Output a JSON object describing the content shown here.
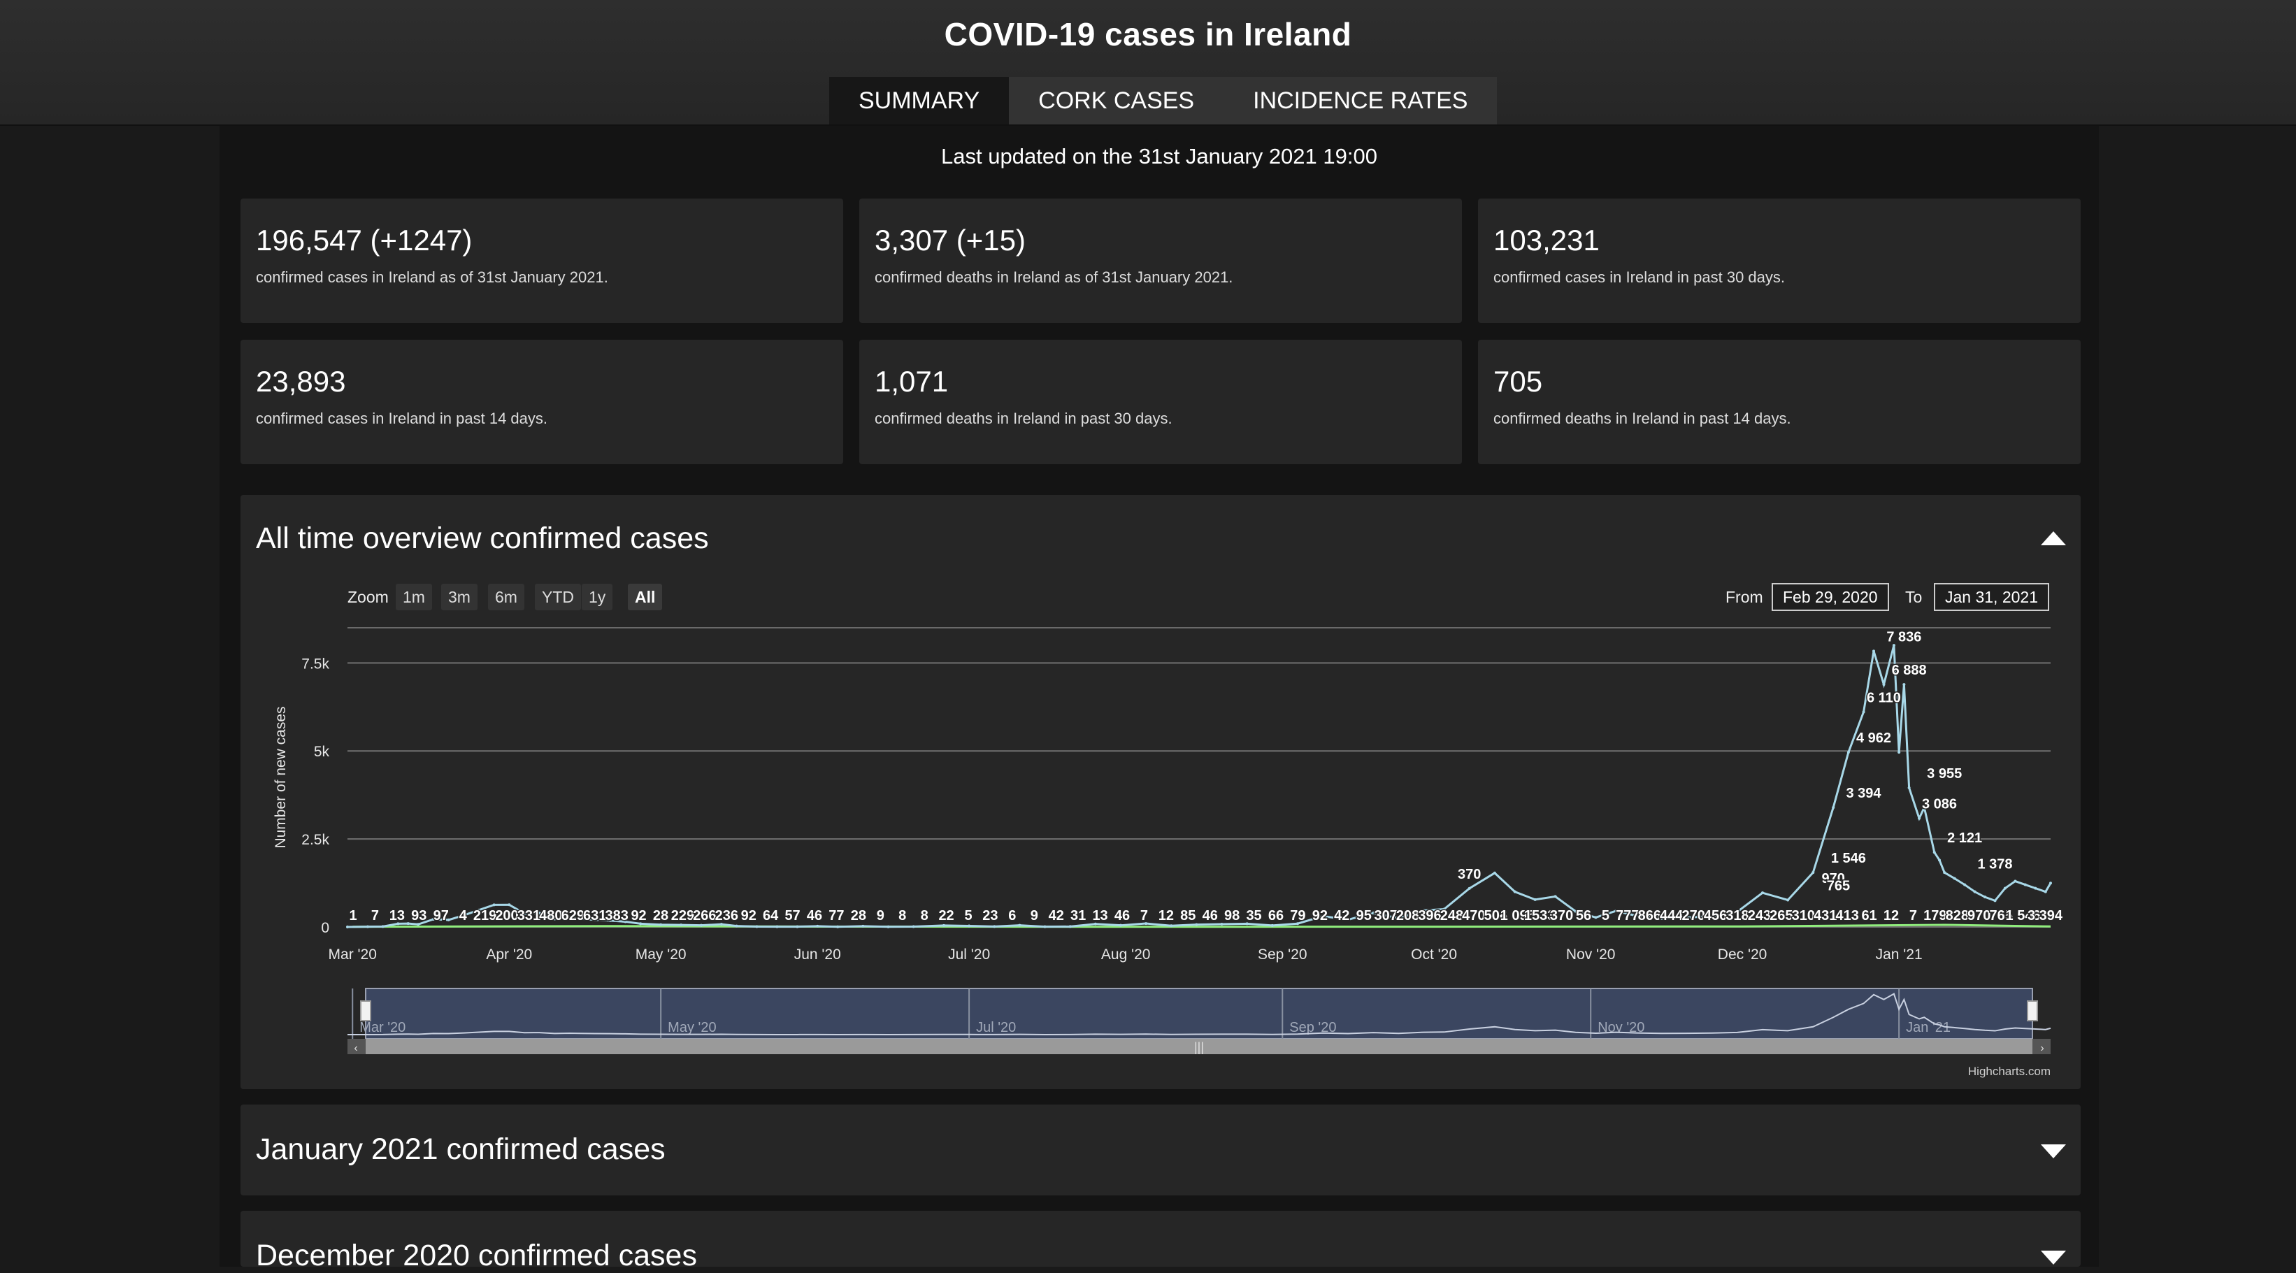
{
  "header": {
    "title": "COVID-19 cases in Ireland",
    "tabs": [
      {
        "label": "SUMMARY",
        "active": true
      },
      {
        "label": "CORK CASES",
        "active": false
      },
      {
        "label": "INCIDENCE RATES",
        "active": false
      }
    ]
  },
  "last_updated": "Last updated on the 31st January 2021 19:00",
  "stats": [
    {
      "value": "196,547 (+1247)",
      "description": "confirmed cases in Ireland as of 31st January 2021."
    },
    {
      "value": "3,307 (+15)",
      "description": "confirmed deaths in Ireland as of 31st January 2021."
    },
    {
      "value": "103,231",
      "description": "confirmed cases in Ireland in past 30 days."
    },
    {
      "value": "23,893",
      "description": "confirmed cases in Ireland in past 14 days."
    },
    {
      "value": "1,071",
      "description": "confirmed deaths in Ireland in past 30 days."
    },
    {
      "value": "705",
      "description": "confirmed deaths in Ireland in past 14 days."
    }
  ],
  "overview_panel": {
    "title": "All time overview confirmed cases",
    "range_selector": {
      "zoom_label": "Zoom",
      "buttons": [
        "1m",
        "3m",
        "6m",
        "YTD",
        "1y",
        "All"
      ],
      "selected": "All",
      "from_label": "From",
      "from_value": "Feb 29, 2020",
      "to_label": "To",
      "to_value": "Jan 31, 2021"
    },
    "credit": "Highcharts.com"
  },
  "collapsed_panels": [
    {
      "title": "January 2021 confirmed cases"
    },
    {
      "title": "December 2020 confirmed cases"
    }
  ],
  "colors": {
    "cases_line": "#a8d8e8",
    "deaths_line": "#90ed7d",
    "navigator_fill": "#3b4660"
  },
  "chart_data": {
    "type": "line",
    "ylabel": "Number of new cases",
    "ylim": [
      0,
      8500
    ],
    "yticks": [
      0,
      2500,
      5000,
      7500
    ],
    "ytick_labels": [
      "0",
      "2.5k",
      "5k",
      "7.5k"
    ],
    "x_tick_labels": [
      "Mar '20",
      "Apr '20",
      "May '20",
      "Jun '20",
      "Jul '20",
      "Aug '20",
      "Sep '20",
      "Oct '20",
      "Nov '20",
      "Dec '20",
      "Jan '21"
    ],
    "navigator_labels": [
      "Mar '20",
      "May '20",
      "Jul '20",
      "Sep '20",
      "Nov '20",
      "Jan '21"
    ],
    "grid": true,
    "series": [
      {
        "x": [
          "2020-02-29",
          "2020-03-04",
          "2020-03-07",
          "2020-03-10",
          "2020-03-12",
          "2020-03-14",
          "2020-03-17",
          "2020-03-20",
          "2020-03-23",
          "2020-03-26",
          "2020-03-29",
          "2020-04-01",
          "2020-04-04",
          "2020-04-07",
          "2020-04-10",
          "2020-04-13",
          "2020-04-15",
          "2020-04-18",
          "2020-04-21",
          "2020-04-24",
          "2020-04-27",
          "2020-05-01",
          "2020-05-05",
          "2020-05-09",
          "2020-05-13",
          "2020-05-16",
          "2020-05-20",
          "2020-05-24",
          "2020-05-28",
          "2020-06-01",
          "2020-06-05",
          "2020-06-10",
          "2020-06-15",
          "2020-06-20",
          "2020-06-26",
          "2020-07-01",
          "2020-07-06",
          "2020-07-11",
          "2020-07-16",
          "2020-07-21",
          "2020-07-26",
          "2020-07-31",
          "2020-08-05",
          "2020-08-10",
          "2020-08-15",
          "2020-08-20",
          "2020-08-25",
          "2020-08-30",
          "2020-09-04",
          "2020-09-09",
          "2020-09-14",
          "2020-09-19",
          "2020-09-24",
          "2020-09-29",
          "2020-10-03",
          "2020-10-08",
          "2020-10-13",
          "2020-10-17",
          "2020-10-21",
          "2020-10-25",
          "2020-10-29",
          "2020-11-02",
          "2020-11-06",
          "2020-11-10",
          "2020-11-15",
          "2020-11-20",
          "2020-11-25",
          "2020-11-30",
          "2020-12-05",
          "2020-12-10",
          "2020-12-15",
          "2020-12-19",
          "2020-12-22",
          "2020-12-25",
          "2020-12-27",
          "2020-12-29",
          "2020-12-31",
          "2021-01-01",
          "2021-01-02",
          "2021-01-03",
          "2021-01-05",
          "2021-01-06",
          "2021-01-08",
          "2021-01-09",
          "2021-01-10",
          "2021-01-12",
          "2021-01-14",
          "2021-01-16",
          "2021-01-18",
          "2021-01-20",
          "2021-01-22",
          "2021-01-24",
          "2021-01-26",
          "2021-01-28",
          "2021-01-30",
          "2021-01-31"
        ],
        "values": [
          1,
          7,
          13,
          93,
          97,
          74,
          219,
          200,
          331,
          480,
          629,
          631,
          383,
          392,
          229,
          266,
          236,
          200,
          180,
          150,
          92,
          64,
          57,
          46,
          77,
          28,
          9,
          8,
          8,
          22,
          5,
          23,
          6,
          9,
          42,
          31,
          13,
          46,
          7,
          12,
          85,
          46,
          98,
          35,
          66,
          79,
          92,
          42,
          95,
          307,
          208,
          396,
          248,
          470,
          506,
          1095,
          1533,
          1000,
          777,
          866,
          444,
          270,
          456,
          318,
          243,
          265,
          310,
          431,
          970,
          765,
          1546,
          3394,
          4962,
          6110,
          7836,
          6888,
          8000,
          4962,
          6888,
          3955,
          3086,
          3394,
          2121,
          1900,
          1546,
          1378,
          1200,
          1000,
          851,
          747,
          1100,
          1300,
          1200,
          1100,
          1000,
          1247
        ]
      },
      {
        "x": [
          "2020-03-01",
          "2020-04-20",
          "2020-06-01",
          "2020-08-01",
          "2020-10-01",
          "2020-12-01",
          "2021-01-10",
          "2021-01-31"
        ],
        "values": [
          5,
          25,
          10,
          5,
          8,
          15,
          60,
          15
        ]
      }
    ],
    "data_labels": [
      "1",
      "7",
      "13",
      "93",
      "97",
      "4",
      "219",
      "200",
      "331",
      "480",
      "629",
      "631",
      "383",
      "92",
      "28",
      "229",
      "266",
      "236",
      "92",
      "64",
      "57",
      "46",
      "77",
      "28",
      "9",
      "8",
      "8",
      "22",
      "5",
      "23",
      "6",
      "9",
      "42",
      "31",
      "13",
      "46",
      "7",
      "12",
      "85",
      "46",
      "98",
      "35",
      "66",
      "79",
      "92",
      "42",
      "95",
      "307",
      "208",
      "396",
      "248",
      "470",
      "506",
      "1 095",
      "1533",
      "370",
      "56",
      "5",
      "777",
      "866",
      "444",
      "270",
      "456",
      "318",
      "243",
      "265",
      "310",
      "431",
      "413",
      "61",
      "12",
      "7",
      "179",
      "828",
      "970",
      "765",
      "1 546",
      "3 394",
      "4 962",
      "6 110",
      "7 836",
      "6 888",
      "3 955",
      "3 086",
      "2 121",
      "1 378",
      "851",
      "7",
      "4",
      "7"
    ]
  }
}
